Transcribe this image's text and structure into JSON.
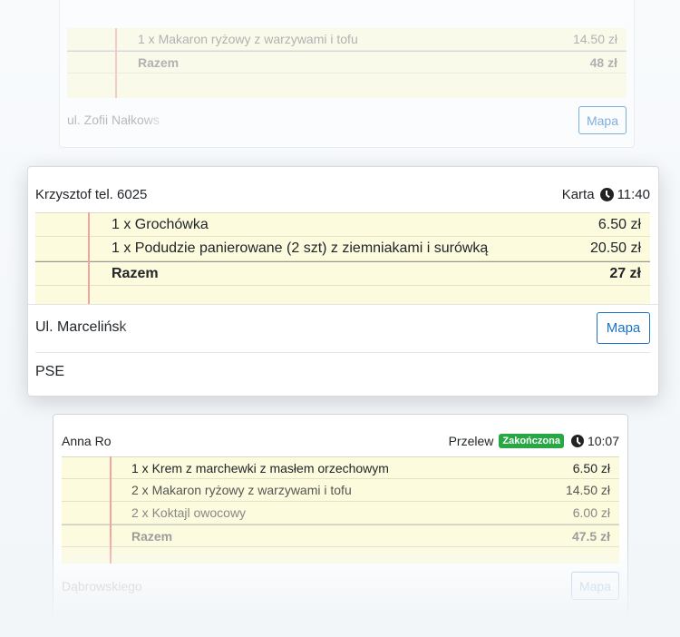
{
  "top_card": {
    "items": [
      {
        "desc": "1 x Makaron ryżowy z warzywami i tofu",
        "price": "14.50 zł"
      }
    ],
    "total_label": "Razem",
    "total_value": "48 zł",
    "address": "ul. Zofii Nałkows",
    "map_label": "Mapa"
  },
  "main_card": {
    "customer": "Krzysztof tel. 6025",
    "payment": "Karta",
    "time": "11:40",
    "items": [
      {
        "desc": "1 x Grochówka",
        "price": "6.50 zł"
      },
      {
        "desc": "1 x Podudzie panierowane (2 szt) z ziemniakami i surówką",
        "price": "20.50 zł"
      }
    ],
    "total_label": "Razem",
    "total_value": "27 zł",
    "address": "Ul. Marcelińsk",
    "map_label": "Mapa",
    "note": "PSE"
  },
  "bottom_card": {
    "customer": "Anna Ro",
    "payment": "Przelew",
    "status": "Zakończona",
    "time": "10:07",
    "items": [
      {
        "desc": "1 x Krem z marchewki z masłem orzechowym",
        "price": "6.50 zł"
      },
      {
        "desc": "2 x Makaron ryżowy z warzywami i tofu",
        "price": "14.50 zł"
      },
      {
        "desc": "2 x Koktajl owocowy",
        "price": "6.00 zł"
      }
    ],
    "total_label": "Razem",
    "total_value": "47.5 zł",
    "address": "Dąbrowskiego",
    "map_label": "Mapa"
  },
  "colors": {
    "table_bg": "#fdfbdd",
    "margin_line": "#f2a3a3",
    "accent": "#1a73c7",
    "status_badge": "#28a745"
  }
}
